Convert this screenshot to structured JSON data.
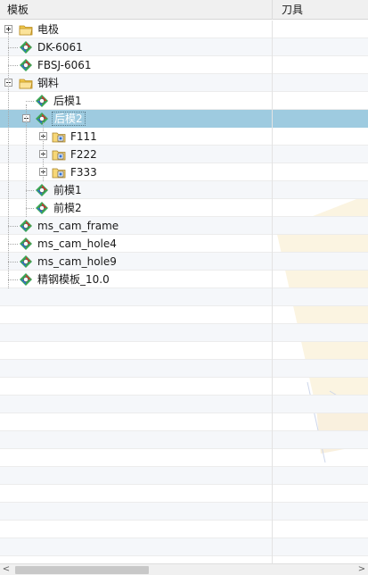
{
  "header": {
    "col1": "模板",
    "col2": "刀具"
  },
  "tree": [
    {
      "label": "电极",
      "icon": "folder",
      "indent": 0,
      "toggle": "plus"
    },
    {
      "label": "DK-6061",
      "icon": "part",
      "indent": 0
    },
    {
      "label": "FBSJ-6061",
      "icon": "part",
      "indent": 0
    },
    {
      "label": "钢料",
      "icon": "folder",
      "indent": 0,
      "toggle": "minus"
    },
    {
      "label": "后模1",
      "icon": "part",
      "indent": 1
    },
    {
      "label": "后模2",
      "icon": "part",
      "indent": 1,
      "toggle": "minus",
      "selected": true
    },
    {
      "label": "F111",
      "icon": "group",
      "indent": 2,
      "toggle": "plus"
    },
    {
      "label": "F222",
      "icon": "group",
      "indent": 2,
      "toggle": "plus"
    },
    {
      "label": "F333",
      "icon": "group",
      "indent": 2,
      "toggle": "plus"
    },
    {
      "label": "前模1",
      "icon": "part",
      "indent": 1
    },
    {
      "label": "前模2",
      "icon": "part",
      "indent": 1
    },
    {
      "label": "ms_cam_frame",
      "icon": "part",
      "indent": 0
    },
    {
      "label": "ms_cam_hole4",
      "icon": "part",
      "indent": 0
    },
    {
      "label": "ms_cam_hole9",
      "icon": "part",
      "indent": 0
    },
    {
      "label": "精钢模板_10.0",
      "icon": "part",
      "indent": 0
    }
  ],
  "scrollbar": {
    "left_arrow": "<",
    "right_arrow": ">"
  },
  "colors": {
    "selected": "#9ecbe0",
    "header_bg": "#f0f0f0",
    "folder": "#f2c94c",
    "part_red": "#d9342b",
    "part_green": "#3aa655",
    "part_blue": "#2a6fd6"
  }
}
